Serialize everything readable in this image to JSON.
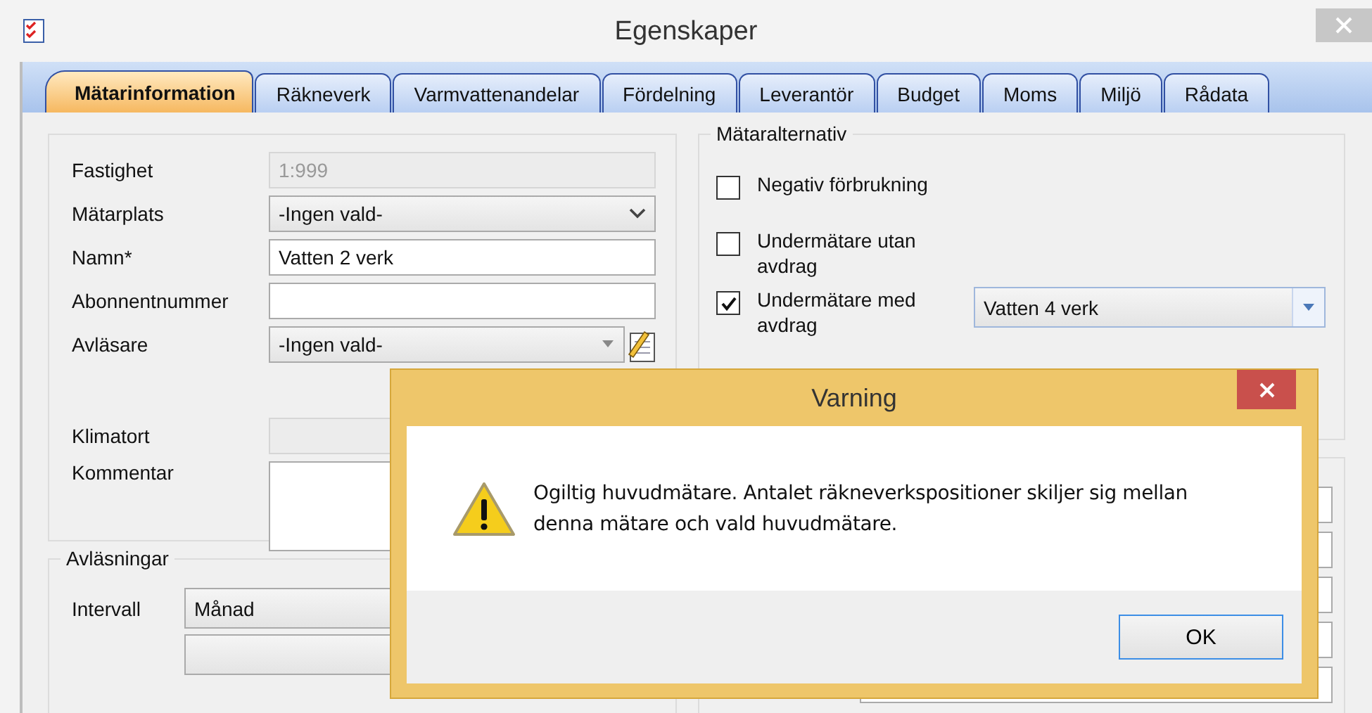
{
  "window": {
    "title": "Egenskaper"
  },
  "tabs": [
    {
      "label": "Mätarinformation",
      "selected": true
    },
    {
      "label": "Räkneverk",
      "selected": false
    },
    {
      "label": "Varmvattenandelar",
      "selected": false
    },
    {
      "label": "Fördelning",
      "selected": false
    },
    {
      "label": "Leverantör",
      "selected": false
    },
    {
      "label": "Budget",
      "selected": false
    },
    {
      "label": "Moms",
      "selected": false
    },
    {
      "label": "Miljö",
      "selected": false
    },
    {
      "label": "Rådata",
      "selected": false
    }
  ],
  "meter_fields": [
    {
      "label": "Fastighet",
      "kind": "readonly",
      "value": "1:999"
    },
    {
      "label": "Mätarplats",
      "kind": "dropdown",
      "value": "-Ingen vald-"
    },
    {
      "label": "Namn*",
      "kind": "text",
      "value": "Vatten 2 verk"
    },
    {
      "label": "Abonnentnummer",
      "kind": "text"
    },
    {
      "label": "Avläsare",
      "kind": "combo",
      "value": "-Ingen vald-"
    },
    {
      "label": "Klimatort",
      "kind": "readonly"
    },
    {
      "label": "Kommentar",
      "kind": "textarea"
    }
  ],
  "meter_options": {
    "title": "Mätaralternativ",
    "options": [
      {
        "label": "Negativ förbrukning",
        "checked": false
      },
      {
        "label": "Undermätare utan avdrag",
        "checked": false
      },
      {
        "label": "Undermätare med avdrag",
        "checked": true,
        "combo_value": "Vatten 4 verk"
      }
    ]
  },
  "readings": {
    "title": "Avläsningar",
    "fields": [
      {
        "label": "Intervall",
        "value": "Månad"
      }
    ]
  },
  "dialog": {
    "title": "Varning",
    "message": "Ogiltig huvudmätare. Antalet räkneverkspositioner skiljer sig mellan denna mätare och vald huvudmätare.",
    "buttons": [
      "OK"
    ]
  }
}
